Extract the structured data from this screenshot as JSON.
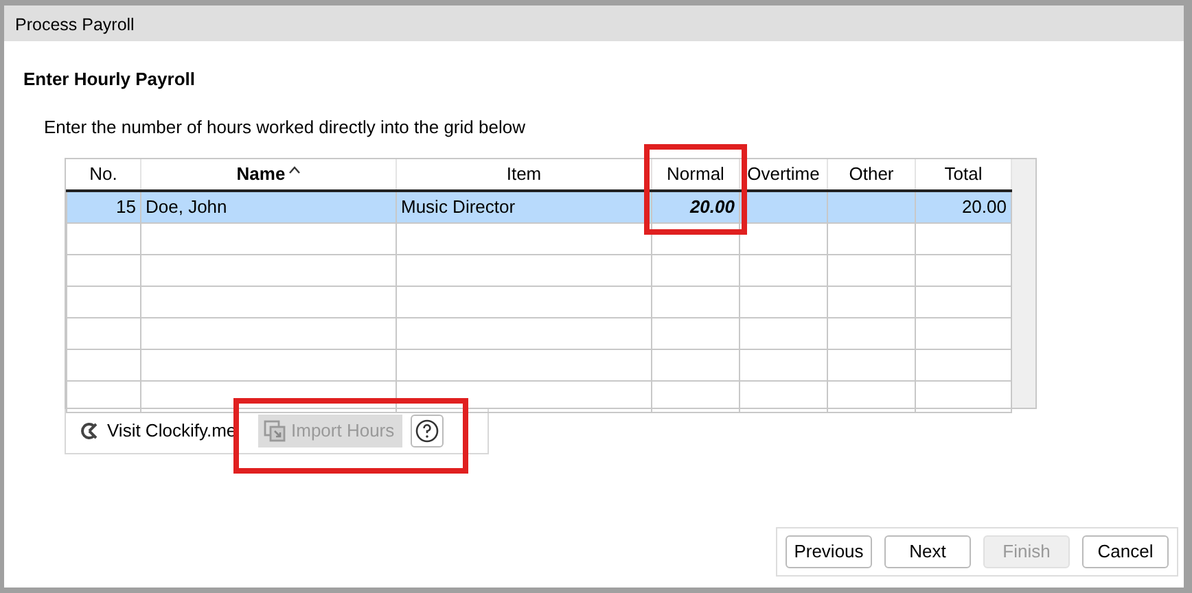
{
  "window": {
    "title": "Process Payroll"
  },
  "heading": "Enter Hourly Payroll",
  "instruction": "Enter the number of hours worked directly into the grid below",
  "table": {
    "columns": [
      {
        "label": "No.",
        "sorted": false
      },
      {
        "label": "Name",
        "sorted": true
      },
      {
        "label": "Item",
        "sorted": false
      },
      {
        "label": "Normal",
        "sorted": false
      },
      {
        "label": "Overtime",
        "sorted": false
      },
      {
        "label": "Other",
        "sorted": false
      },
      {
        "label": "Total",
        "sorted": false
      }
    ],
    "rows": [
      {
        "selected": true,
        "cells": [
          "15",
          "Doe, John",
          "Music Director",
          "20.00",
          "",
          "",
          "20.00"
        ]
      }
    ]
  },
  "tools": {
    "link": "Visit Clockify.me",
    "import_button": {
      "label": "Import Hours",
      "disabled": true
    }
  },
  "buttons": [
    {
      "label": "Previous",
      "disabled": false
    },
    {
      "label": "Next",
      "disabled": false
    },
    {
      "label": "Finish",
      "disabled": true
    },
    {
      "label": "Cancel",
      "disabled": false
    }
  ]
}
